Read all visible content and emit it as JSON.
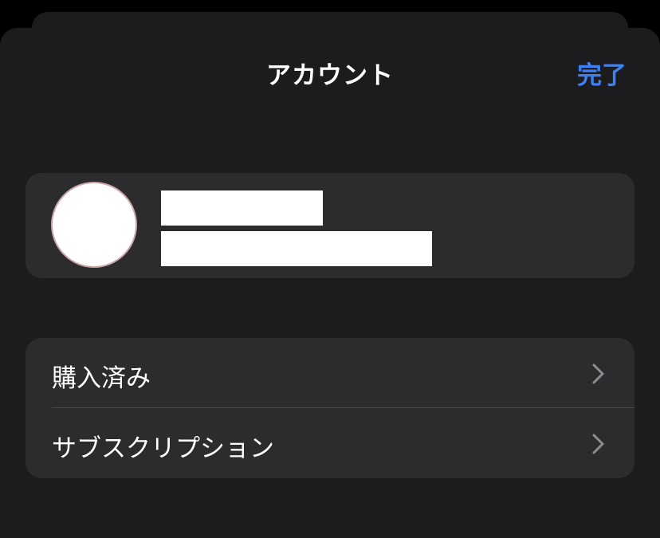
{
  "header": {
    "title": "アカウント",
    "done_label": "完了"
  },
  "profile": {
    "avatar_icon": "avatar-placeholder",
    "name_redacted": true,
    "email_redacted": true
  },
  "menu": {
    "items": [
      {
        "label": "購入済み",
        "icon": "chevron-right-icon"
      },
      {
        "label": "サブスクリプション",
        "icon": "chevron-right-icon"
      }
    ]
  },
  "colors": {
    "background": "#000000",
    "sheet": "#1c1c1e",
    "card": "#2c2c2e",
    "accent": "#3b82f6",
    "chevron": "#8e8e93"
  }
}
